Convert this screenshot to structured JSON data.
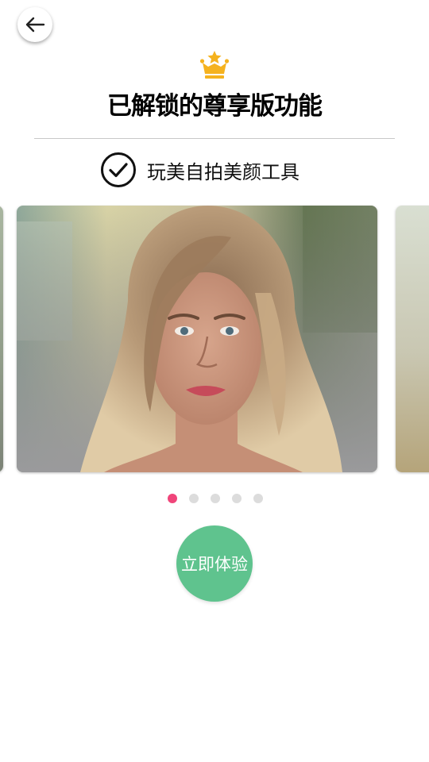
{
  "header": {
    "back_icon": "arrow-left-icon",
    "crown_icon": "crown-icon",
    "title": "已解锁的尊享版功能"
  },
  "feature": {
    "check_icon": "check-circle-icon",
    "label": "玩美自拍美颜工具"
  },
  "carousel": {
    "slide_count": 5,
    "active_index": 0
  },
  "cta": {
    "label": "立即体验"
  },
  "colors": {
    "accent_pink": "#f0457a",
    "cta_green": "#5fc38e",
    "crown_gold": "#f5b21e",
    "dot_inactive": "#dcdcdc"
  }
}
